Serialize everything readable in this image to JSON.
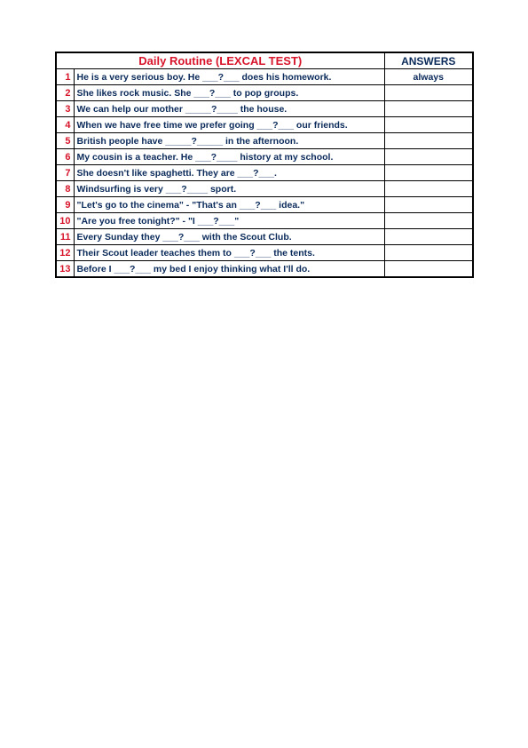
{
  "title": "Daily Routine (LEXCAL TEST)",
  "answers_head": "ANSWERS",
  "rows": [
    {
      "n": "1",
      "q": "He is a very serious boy. He ___?___ does his homework.",
      "a": "always"
    },
    {
      "n": "2",
      "q": "She likes rock music. She ___?___ to pop groups.",
      "a": ""
    },
    {
      "n": "3",
      "q": "We can help our mother _____?____ the house.",
      "a": ""
    },
    {
      "n": "4",
      "q": "When we have free time we prefer going ___?___ our friends.",
      "a": ""
    },
    {
      "n": "5",
      "q": "British people have _____?_____ in the afternoon.",
      "a": ""
    },
    {
      "n": "6",
      "q": "My cousin is a teacher. He ___?____ history at my school.",
      "a": ""
    },
    {
      "n": "7",
      "q": "She doesn't like spaghetti. They are ___?___.",
      "a": ""
    },
    {
      "n": "8",
      "q": "Windsurfing is very ___?____ sport.",
      "a": ""
    },
    {
      "n": "9",
      "q": "\"Let's go to the cinema\" - \"That's an ___?___ idea.\"",
      "a": ""
    },
    {
      "n": "10",
      "q": "\"Are you free tonight?\" - \"I ___?___\"",
      "a": ""
    },
    {
      "n": "11",
      "q": "Every Sunday they ___?___ with the Scout Club.",
      "a": ""
    },
    {
      "n": "12",
      "q": "Their Scout leader teaches them to ___?___ the tents.",
      "a": ""
    },
    {
      "n": "13",
      "q": "Before I ___?___ my bed I enjoy thinking what I'll do.",
      "a": ""
    }
  ]
}
